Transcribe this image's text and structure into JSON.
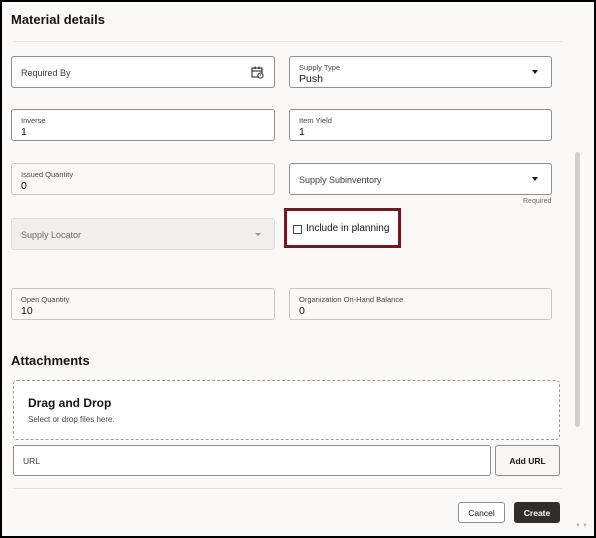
{
  "sections": {
    "material_details": "Material details",
    "attachments": "Attachments"
  },
  "fields": {
    "required_by": {
      "label": "Required By",
      "icon": "calendar-icon"
    },
    "supply_type": {
      "label": "Supply Type",
      "value": "Push"
    },
    "inverse": {
      "label": "Inverse",
      "value": "1"
    },
    "item_yield": {
      "label": "Item Yield",
      "value": "1"
    },
    "issued_quantity": {
      "label": "Issued Quantity",
      "value": "0"
    },
    "supply_subinventory": {
      "label": "Supply Subinventory",
      "helper": "Required"
    },
    "supply_locator": {
      "label": "Supply Locator"
    },
    "include_in_planning": {
      "label": "Include in planning",
      "checked": false
    },
    "open_quantity": {
      "label": "Open Quantity",
      "value": "10"
    },
    "org_onhand": {
      "label": "Organization On-Hand Balance",
      "value": "0"
    }
  },
  "dropzone": {
    "title": "Drag and Drop",
    "subtitle": "Select or drop files here."
  },
  "url": {
    "placeholder": "URL",
    "add_label": "Add URL"
  },
  "footer": {
    "cancel_label": "Cancel",
    "create_label": "Create"
  },
  "colors": {
    "highlight": "#6e1b1f",
    "primary_button": "#312d2a"
  }
}
